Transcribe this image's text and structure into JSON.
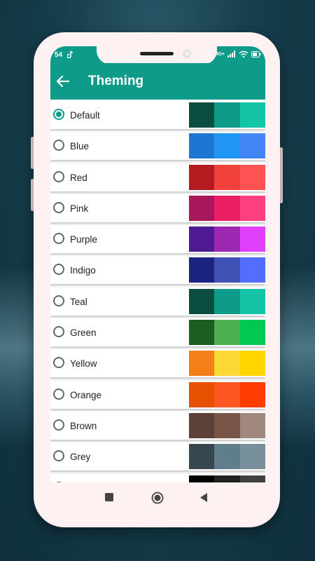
{
  "status": {
    "left": "54",
    "network": "4G+"
  },
  "header": {
    "title": "Theming"
  },
  "themes": [
    {
      "label": "Default",
      "selected": true,
      "colors": [
        "#0b4d3e",
        "#0e9b89",
        "#13c4a6"
      ]
    },
    {
      "label": "Blue",
      "selected": false,
      "colors": [
        "#1d76d1",
        "#2196f2",
        "#4285f4"
      ]
    },
    {
      "label": "Red",
      "selected": false,
      "colors": [
        "#b31b20",
        "#f2403a",
        "#ff5252"
      ]
    },
    {
      "label": "Pink",
      "selected": false,
      "colors": [
        "#a8175a",
        "#ea1e63",
        "#ff4080"
      ]
    },
    {
      "label": "Purple",
      "selected": false,
      "colors": [
        "#4e1a96",
        "#9c27b0",
        "#e040fb"
      ]
    },
    {
      "label": "Indigo",
      "selected": false,
      "colors": [
        "#1c237f",
        "#3f51b5",
        "#536dfe"
      ]
    },
    {
      "label": "Teal",
      "selected": false,
      "colors": [
        "#0b4d3e",
        "#0e9b89",
        "#13c4a6"
      ]
    },
    {
      "label": "Green",
      "selected": false,
      "colors": [
        "#1c5e20",
        "#4caf50",
        "#00c853"
      ]
    },
    {
      "label": "Yellow",
      "selected": false,
      "colors": [
        "#f57f17",
        "#fdd835",
        "#ffd600"
      ]
    },
    {
      "label": "Orange",
      "selected": false,
      "colors": [
        "#e65100",
        "#ff5722",
        "#ff3d00"
      ]
    },
    {
      "label": "Brown",
      "selected": false,
      "colors": [
        "#5d4037",
        "#795548",
        "#a1887f"
      ]
    },
    {
      "label": "Grey",
      "selected": false,
      "colors": [
        "#37474f",
        "#607d8b",
        "#78909c"
      ]
    },
    {
      "label": "",
      "selected": false,
      "colors": [
        "#000000",
        "#212121",
        "#424242"
      ]
    }
  ],
  "colors": {
    "accent": "#0f9b8a",
    "frame": "#fdf1f1"
  }
}
